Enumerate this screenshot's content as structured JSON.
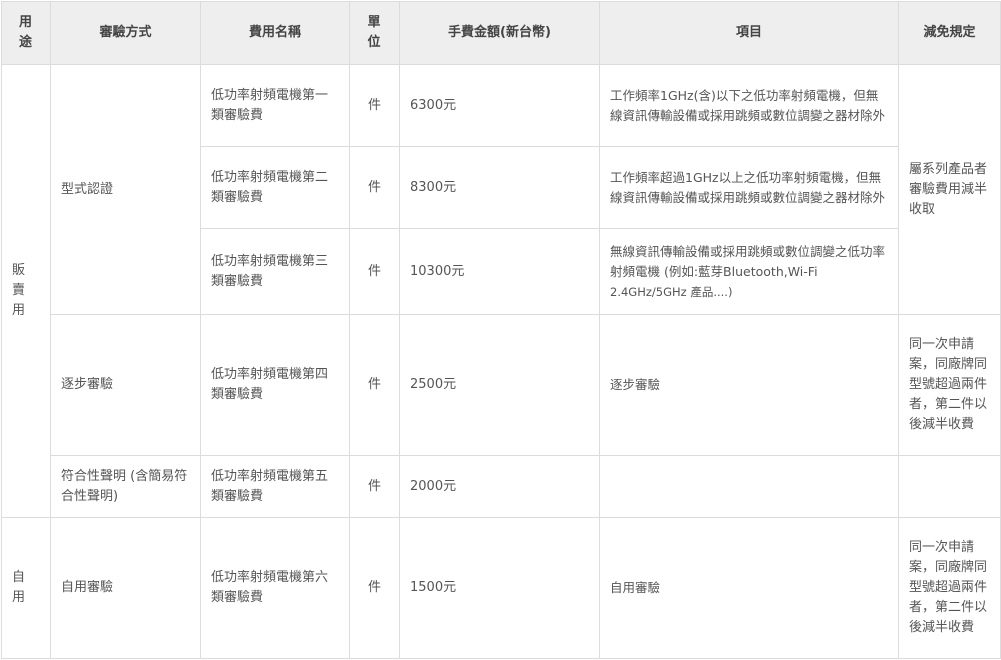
{
  "headers": {
    "usage": "用途",
    "method": "審驗方式",
    "fee_name": "費用名稱",
    "unit": "單位",
    "amount": "手費金額(新台幣)",
    "item": "項目",
    "reduction": "減免規定"
  },
  "groups": {
    "sale": "販賣用",
    "self": "自用"
  },
  "methods": {
    "type_cert": "型式認證",
    "stepwise": "逐步審驗",
    "conformity": "符合性聲明 (含簡易符合性聲明)",
    "self_use": "自用審驗"
  },
  "rows": [
    {
      "fee_name": "低功率射頻電機第一類審驗費",
      "unit": "件",
      "amount": "6300元",
      "item": "工作頻率1GHz(含)以下之低功率射頻電機，但無線資訊傳輸設備或採用跳頻或數位調變之器材除外"
    },
    {
      "fee_name": "低功率射頻電機第二類審驗費",
      "unit": "件",
      "amount": "8300元",
      "item": "工作頻率超過1GHz以上之低功率射頻電機，但無線資訊傳輸設備或採用跳頻或數位調變之器材除外"
    },
    {
      "fee_name": "低功率射頻電機第三類審驗費",
      "unit": "件",
      "amount": "10300元",
      "item": "無線資訊傳輸設備或採用跳頻或數位調變之低功率射頻電機 (例如:藍芽Bluetooth,Wi-Fi",
      "item_small": "2.4GHz/5GHz 產品....)"
    },
    {
      "fee_name": "低功率射頻電機第四類審驗費",
      "unit": "件",
      "amount": "2500元",
      "item": "逐步審驗"
    },
    {
      "fee_name": "低功率射頻電機第五類審驗費",
      "unit": "件",
      "amount": "2000元",
      "item": ""
    },
    {
      "fee_name": "低功率射頻電機第六類審驗費",
      "unit": "件",
      "amount": "1500元",
      "item": "自用審驗"
    }
  ],
  "reductions": {
    "series": "屬系列產品者審驗費用減半收取",
    "same_model": "同一次申請案，同廠牌同型號超過兩件者，第二件以後減半收費",
    "same_model_self": "同一次申請案，同廠牌同型號超過兩件者，第二件以後減半收費"
  }
}
